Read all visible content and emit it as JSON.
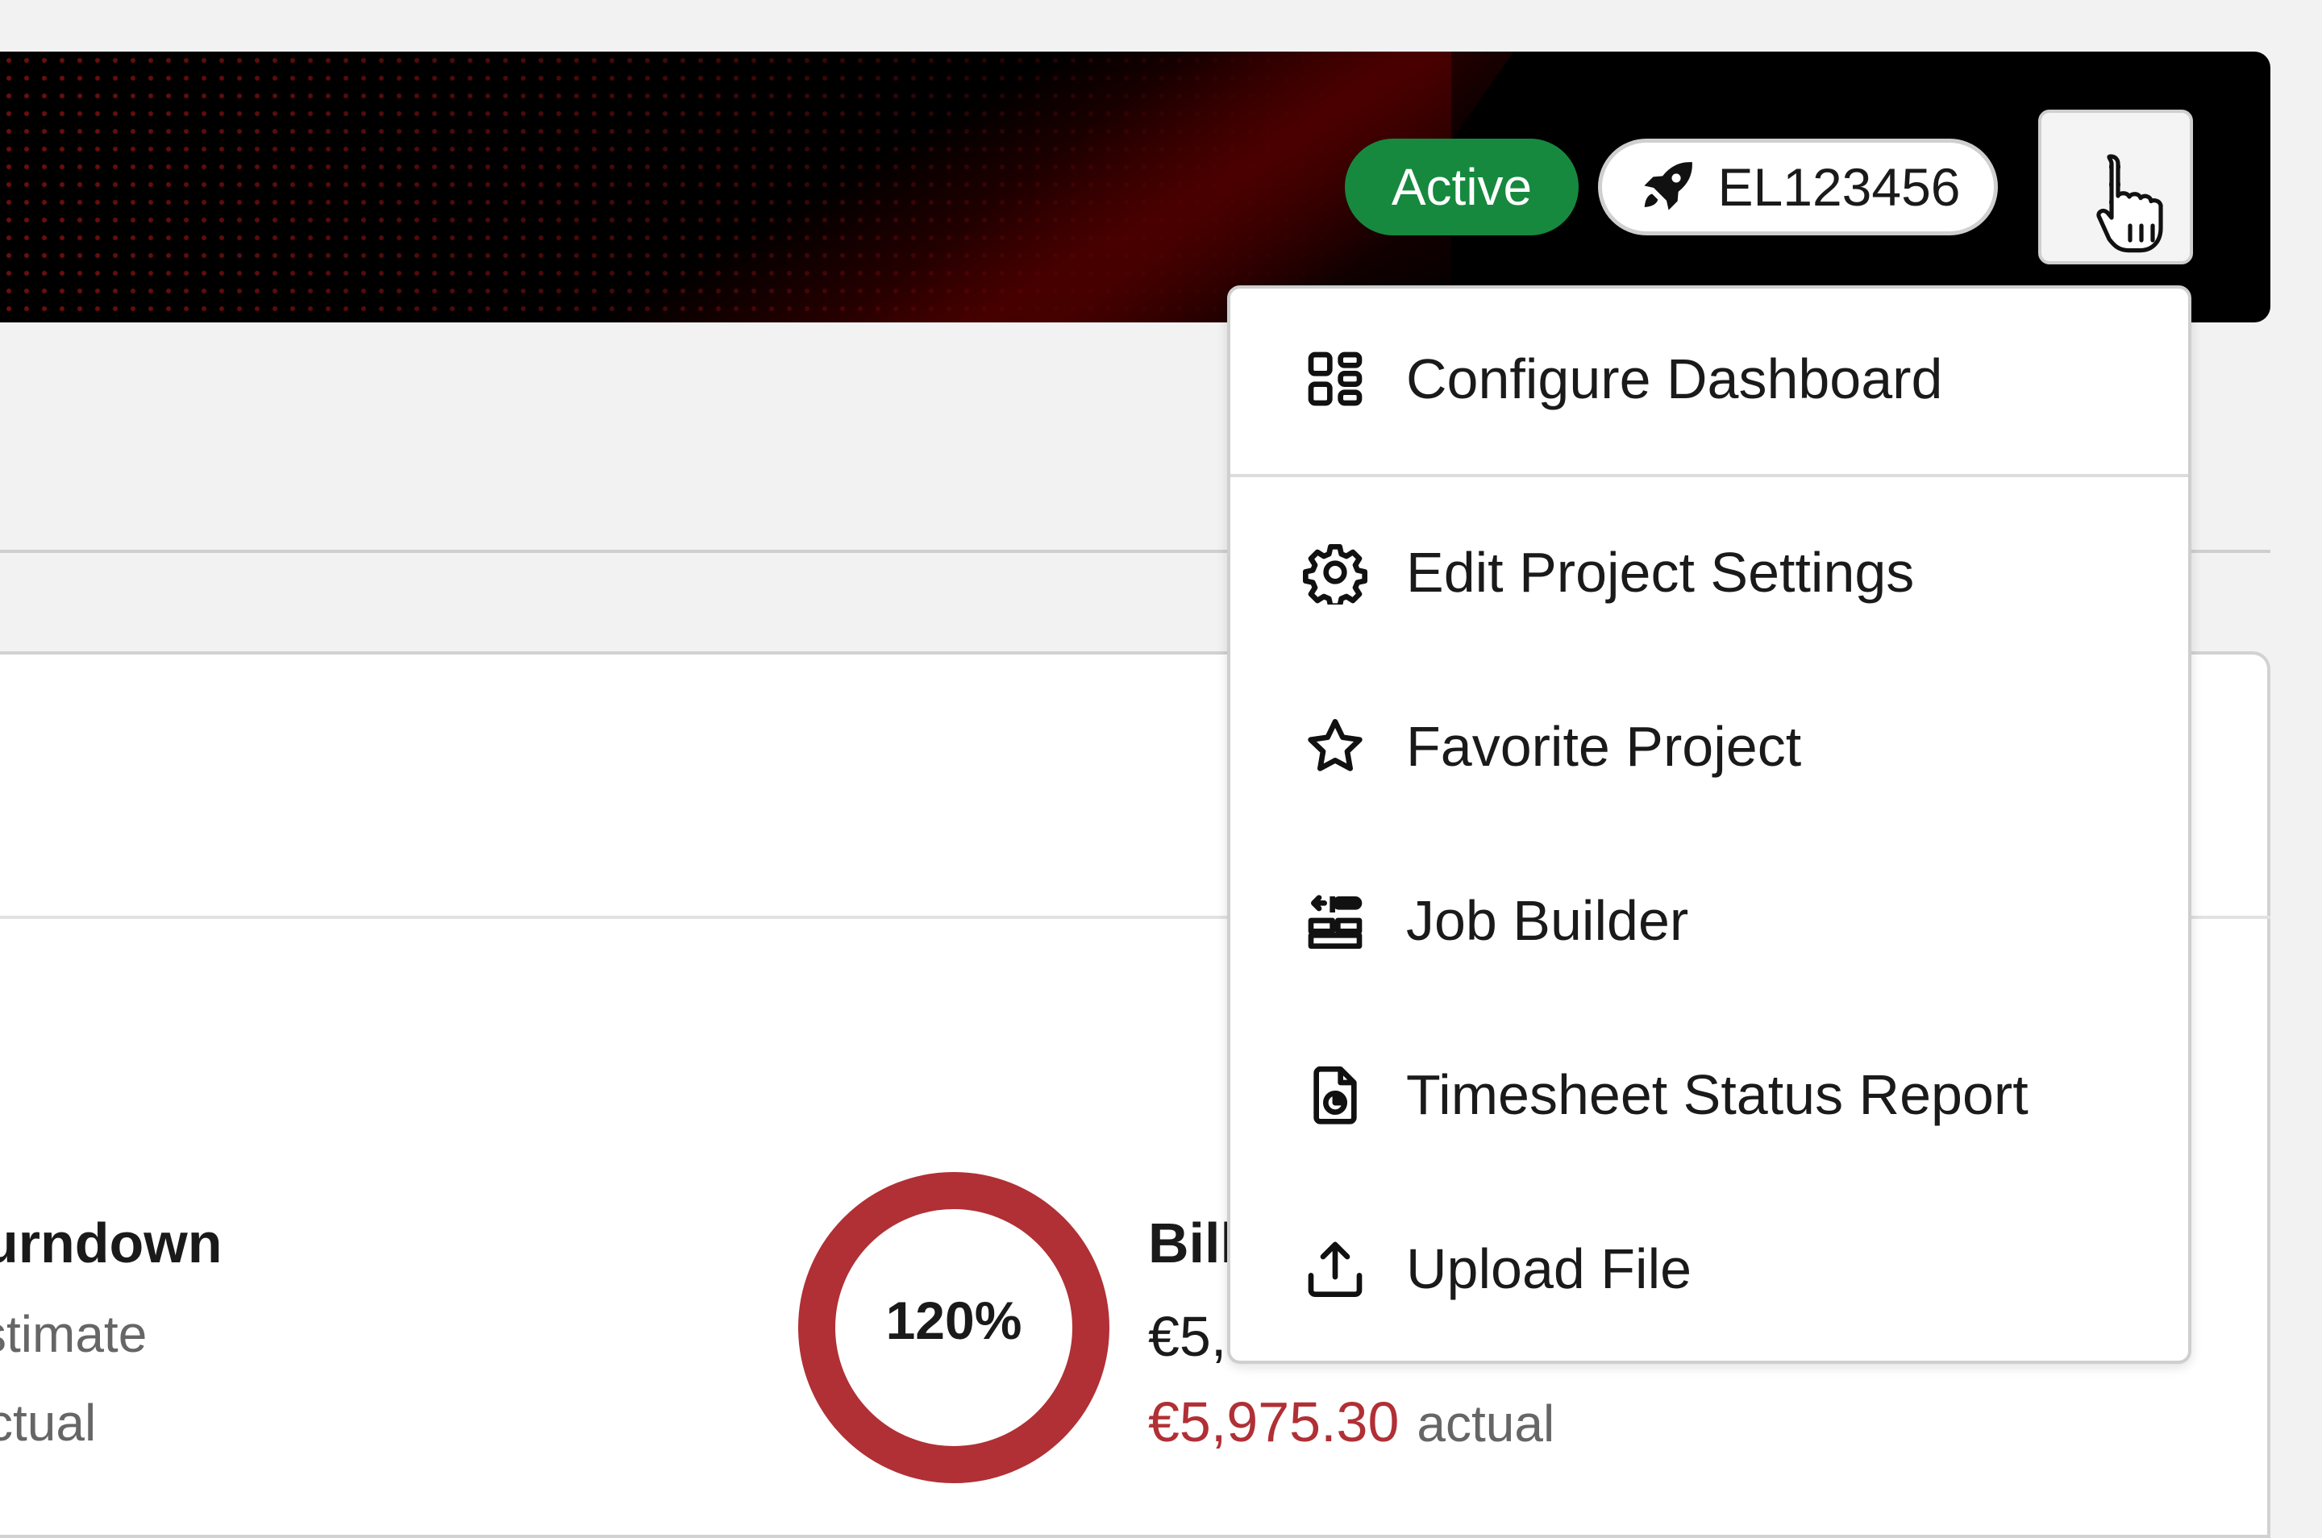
{
  "header": {
    "status_badge": "Active",
    "project_code": "EL123456",
    "status_color": "#16893e",
    "more_button_icon": "kebab-vertical-icon"
  },
  "dropdown": {
    "items": [
      {
        "label": "Configure Dashboard",
        "icon": "dashboard-layout-icon"
      },
      {
        "label": "Edit Project Settings",
        "icon": "gear-icon"
      },
      {
        "label": "Favorite Project",
        "icon": "star-icon"
      },
      {
        "label": "Job Builder",
        "icon": "job-builder-icon"
      },
      {
        "label": "Timesheet Status Report",
        "icon": "report-file-icon"
      },
      {
        "label": "Upload File",
        "icon": "upload-icon"
      }
    ]
  },
  "burndown": {
    "title": "urndown",
    "estimate_label": "stimate",
    "actual_label": "ctual"
  },
  "progress": {
    "percent_text": "120%",
    "color": "#b03035"
  },
  "billing": {
    "title": "Bill",
    "estimate_value": "€5,",
    "actual_value": "€5,975.30",
    "actual_label": "actual"
  }
}
